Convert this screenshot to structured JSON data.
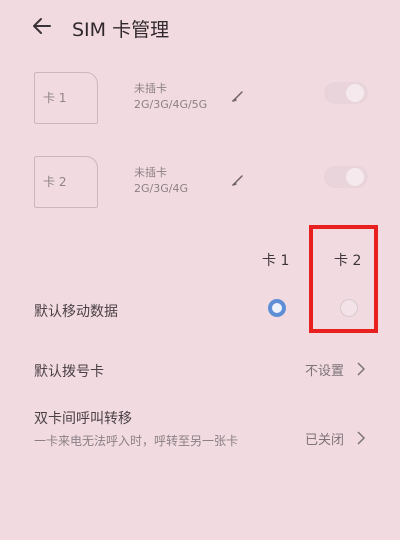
{
  "header": {
    "title": "SIM 卡管理"
  },
  "sims": [
    {
      "slot_label": "卡 1",
      "name": "未插卡",
      "networks": "2G/3G/4G/5G"
    },
    {
      "slot_label": "卡 2",
      "name": "未插卡",
      "networks": "2G/3G/4G"
    }
  ],
  "columns": {
    "card1": "卡 1",
    "card2": "卡 2"
  },
  "rows": {
    "default_data": {
      "label": "默认移动数据"
    },
    "default_dial": {
      "label": "默认拨号卡",
      "value": "不设置"
    },
    "call_forward": {
      "label": "双卡间呼叫转移",
      "description": "一卡来电无法呼入时，呼转至另一张卡",
      "value": "已关闭"
    }
  },
  "colors": {
    "accent": "#5e8fd6",
    "highlight": "#e8201f",
    "background": "#f1dbe0"
  },
  "icons": [
    "back-arrow-icon",
    "edit-pencil-icon",
    "chevron-right-icon"
  ]
}
